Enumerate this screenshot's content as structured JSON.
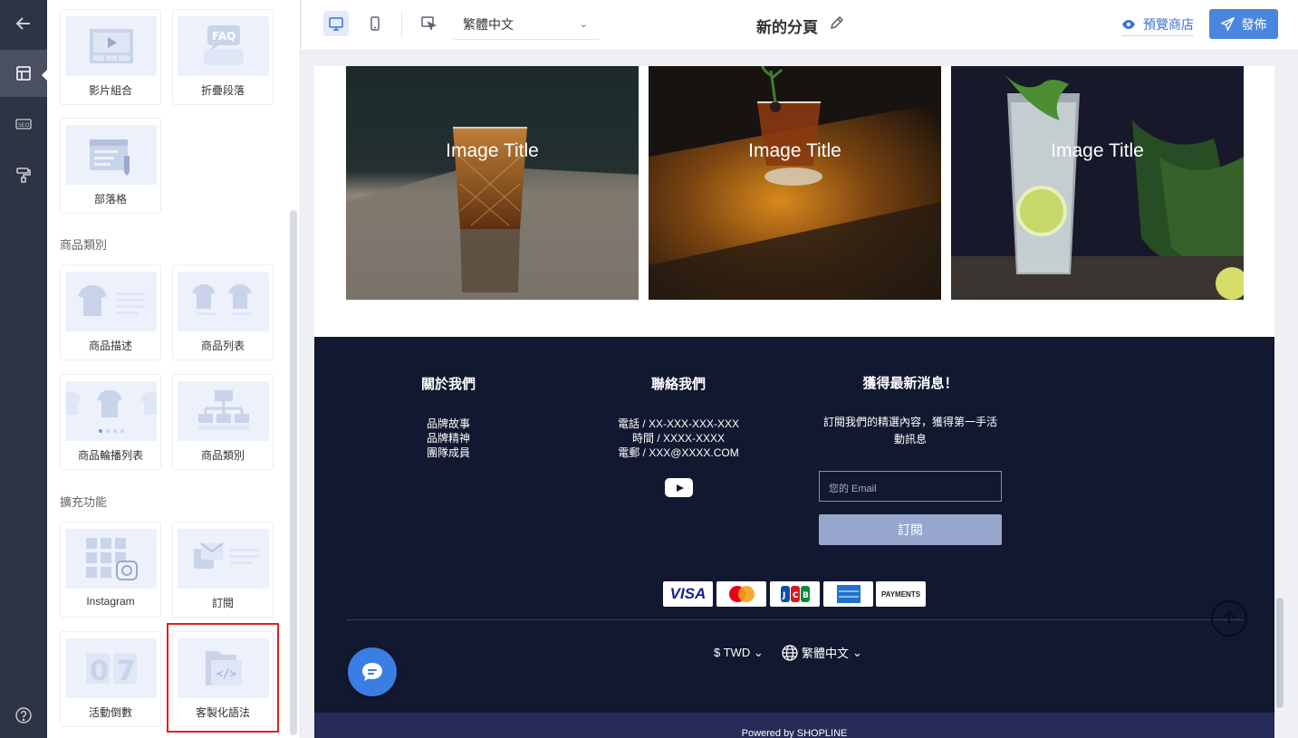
{
  "rail": {
    "back_icon": "arrow-left-icon",
    "layout_icon": "layout-icon",
    "seo_icon": "seo-icon",
    "theme_icon": "paint-roller-icon",
    "help_icon": "help-icon"
  },
  "panel": {
    "top_cards": [
      {
        "label": "影片組合",
        "icon": "video-gallery-icon"
      },
      {
        "label": "折疊段落",
        "icon": "faq-icon"
      },
      {
        "label": "部落格",
        "icon": "blog-icon"
      }
    ],
    "sections": [
      {
        "title": "商品類別",
        "cards": [
          {
            "label": "商品描述",
            "icon": "product-description-icon"
          },
          {
            "label": "商品列表",
            "icon": "product-list-icon"
          },
          {
            "label": "商品輪播列表",
            "icon": "product-carousel-icon"
          },
          {
            "label": "商品類別",
            "icon": "product-category-icon"
          }
        ]
      },
      {
        "title": "擴充功能",
        "cards": [
          {
            "label": "Instagram",
            "icon": "instagram-icon"
          },
          {
            "label": "訂閱",
            "icon": "subscribe-icon"
          },
          {
            "label": "活動倒數",
            "icon": "countdown-icon"
          },
          {
            "label": "客製化語法",
            "icon": "custom-code-icon"
          }
        ]
      }
    ]
  },
  "topbar": {
    "language": "繁體中文",
    "page_title": "新的分頁",
    "preview_label": "預覽商店",
    "publish_label": "發佈"
  },
  "canvas": {
    "image_titles": [
      "Image Title",
      "Image Title",
      "Image Title"
    ],
    "footer": {
      "about_title": "關於我們",
      "about_lines": [
        "品牌故事",
        "品牌精神",
        "團隊成員"
      ],
      "contact_title": "聯絡我們",
      "contact_lines": [
        "電話 / XX-XXX-XXX-XXX",
        "時間 / XXXX-XXXX",
        "電郵 / XXX@XXXX.COM"
      ],
      "news_title": "獲得最新消息！",
      "news_desc_1": "訂閱我們的精選內容，獲得第一手活",
      "news_desc_2": "動訊息",
      "email_placeholder": "您的 Email",
      "subscribe_label": "訂閱",
      "payments": [
        "VISA",
        "Mastercard",
        "JCB",
        "American Express",
        "PAYMENTS"
      ],
      "currency": "$ TWD",
      "language": "繁體中文",
      "powered_by": "Powered by SHOPLINE"
    }
  },
  "colors": {
    "rail_bg": "#2f3444",
    "footer_bg": "#12182f",
    "accent": "#4a86e0",
    "highlight": "#e02020"
  }
}
